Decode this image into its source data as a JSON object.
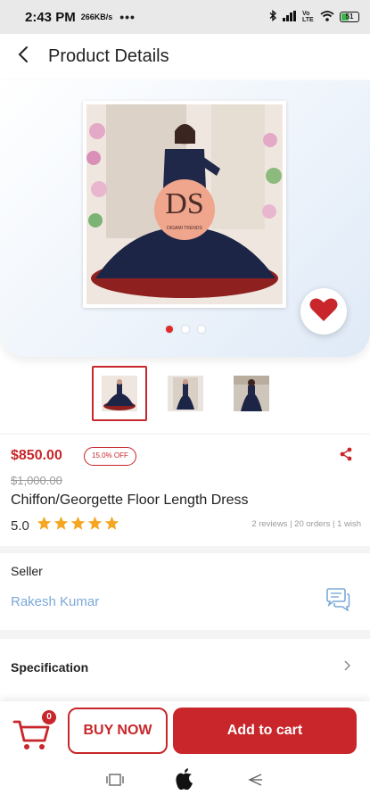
{
  "status_bar": {
    "time": "2:43 PM",
    "speed": "266KB/s",
    "more": "•••",
    "network": "Vo LTE",
    "battery": "51"
  },
  "header": {
    "title": "Product Details",
    "back_icon": "chevron-left-icon"
  },
  "gallery": {
    "image_count": 3,
    "active_index": 0,
    "favorite_icon": "heart-icon",
    "favorite_color": "#c8262a"
  },
  "product": {
    "price": "$850.00",
    "discount": "15.0% OFF",
    "old_price": "$1,000.00",
    "name": "Chiffon/Georgette Floor Length Dress",
    "rating": "5.0",
    "stars": 5,
    "stats": "2 reviews | 20 orders | 1 wish"
  },
  "seller": {
    "label": "Seller",
    "name": "Rakesh Kumar",
    "chat_icon": "chat-icon"
  },
  "specification": {
    "label": "Specification"
  },
  "actions": {
    "cart_count": "0",
    "buy_now": "BUY NOW",
    "add_to_cart": "Add to cart"
  },
  "colors": {
    "accent": "#c8262a",
    "seller_link": "#7da9d8",
    "star": "#f5a623"
  }
}
